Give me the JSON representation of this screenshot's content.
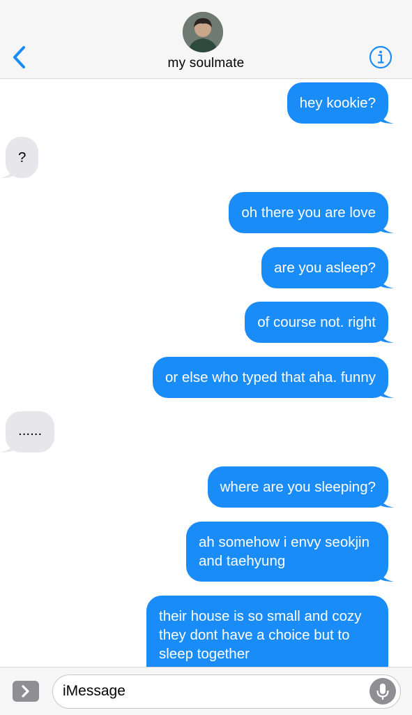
{
  "header": {
    "contact_name": "my soulmate",
    "back_icon": "chevron-left-icon",
    "info_icon": "info-icon",
    "accent_color": "#1a8cf8"
  },
  "messages": [
    {
      "from": "me",
      "text": "hey kookie?"
    },
    {
      "from": "them",
      "text": "?"
    },
    {
      "from": "me",
      "text": "oh there you are love"
    },
    {
      "from": "me",
      "text": "are you asleep?"
    },
    {
      "from": "me",
      "text": "of course not. right"
    },
    {
      "from": "me",
      "text": "or else who typed that aha. funny"
    },
    {
      "from": "them",
      "text": "......"
    },
    {
      "from": "me",
      "text": "where are you sleeping?"
    },
    {
      "from": "me",
      "text": "ah somehow i envy seokjin and taehyung"
    },
    {
      "from": "me",
      "text": "their house is so small and cozy they dont have a choice but to sleep together"
    }
  ],
  "colors": {
    "sent_bubble": "#1a8cf8",
    "received_bubble": "#e6e6eb"
  },
  "input": {
    "placeholder": "iMessage",
    "apps_icon": "chevron-right-icon",
    "mic_icon": "microphone-icon"
  }
}
